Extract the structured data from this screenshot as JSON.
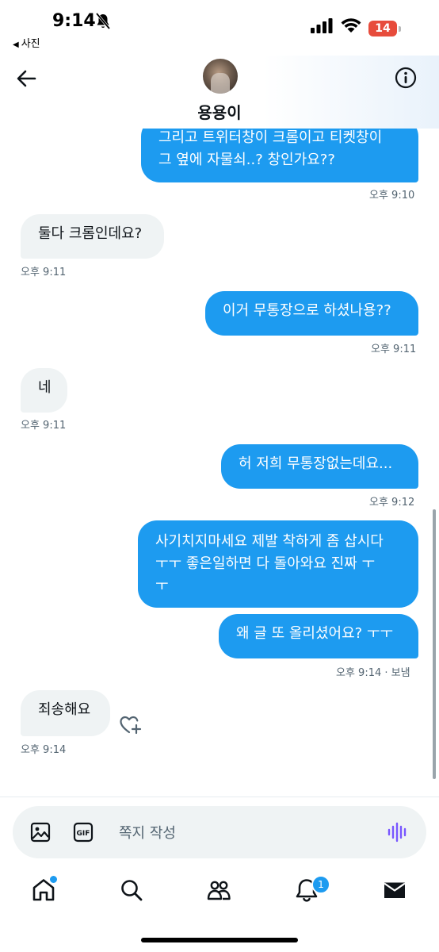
{
  "status_bar": {
    "time": "9:14",
    "back_app": "사진",
    "battery": "14"
  },
  "header": {
    "name": "용용이"
  },
  "messages": [
    {
      "dir": "out",
      "text": "그리고 트위터창이 크롬이고 티켓창이\n그 옆에 자물쇠..? 창인가요??",
      "time": "오후 9:10"
    },
    {
      "dir": "in",
      "text": "둘다 크롬인데요?",
      "time": "오후 9:11"
    },
    {
      "dir": "out",
      "text": "이거 무통장으로 하셨나용??",
      "time": "오후 9:11"
    },
    {
      "dir": "in",
      "text": "네",
      "time": "오후 9:11"
    },
    {
      "dir": "out",
      "text": "허 저희 무통장없는데요...",
      "time": "오후 9:12"
    },
    {
      "dir": "out",
      "text": "사기치지마세요 제발 착하게 좀 삽시다\nㅜㅜ 좋은일하면 다 돌아와요 진짜 ㅜ\nㅜ"
    },
    {
      "dir": "out",
      "text": "왜 글 또 올리셨어요? ㅜㅜ",
      "time": "오후 9:14 · 보냄"
    },
    {
      "dir": "in",
      "text": "죄송해요",
      "time": "오후 9:14"
    }
  ],
  "composer": {
    "placeholder": "쪽지 작성"
  },
  "tabbar": {
    "notification_count": "1"
  },
  "colors": {
    "accent": "#1d9bf0",
    "incoming": "#eff3f4",
    "voice": "#7856ff"
  },
  "icons": [
    "back-arrow-icon",
    "info-icon",
    "image-icon",
    "gif-icon",
    "voice-icon",
    "home-icon",
    "search-icon",
    "communities-icon",
    "bell-icon",
    "mail-icon",
    "heart-plus-icon"
  ]
}
